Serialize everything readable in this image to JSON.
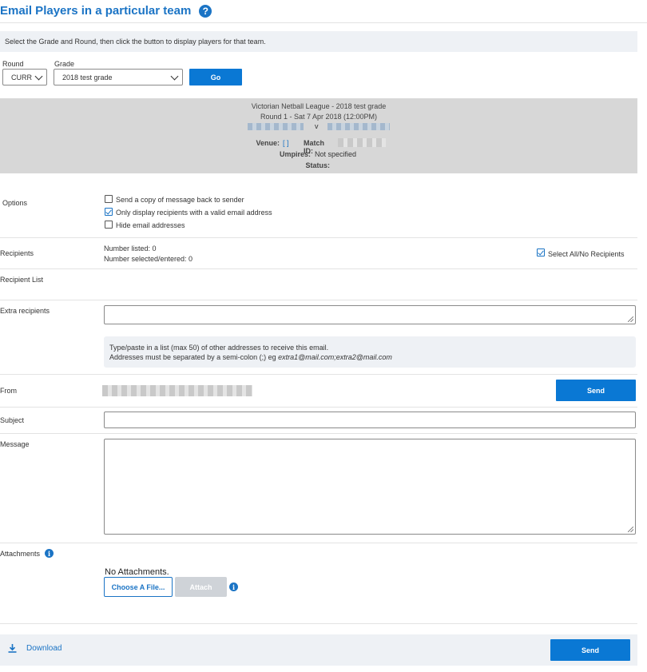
{
  "page": {
    "title": "Email Players in a particular team",
    "help_icon": "?",
    "hint": "Select the Grade and Round, then click the button to display players for that team."
  },
  "filters": {
    "round_label": "Round",
    "round_value": "CURR",
    "grade_label": "Grade",
    "grade_value": "2018 test grade",
    "go_label": "Go"
  },
  "match": {
    "competition": "Victorian Netball League - 2018 test grade",
    "round": "Round 1 - Sat 7 Apr 2018 (12:00PM)",
    "versus": "v",
    "venue_label": "Venue:",
    "venue_value": "[ ]",
    "match_id_label": "Match ID:",
    "umpires_label": "Umpires:",
    "umpires_value": "Not specified",
    "status_label": "Status:"
  },
  "options": {
    "label": "Options",
    "items": [
      {
        "label": "Send a copy of message back to sender",
        "checked": false
      },
      {
        "label": "Only display recipients with a valid email address",
        "checked": true
      },
      {
        "label": "Hide email addresses",
        "checked": false
      }
    ]
  },
  "recipients": {
    "label": "Recipients",
    "listed": "Number listed: 0",
    "selected": "Number selected/entered: 0",
    "select_all_label": "Select All/No Recipients",
    "select_all_checked": true,
    "list_label": "Recipient List"
  },
  "extra": {
    "label": "Extra recipients",
    "value": "",
    "info_line1": "Type/paste in a list (max 50) of other addresses to receive this email.",
    "info_line2_prefix": "Addresses must be separated by a semi-colon (;) eg ",
    "info_line2_example": "extra1@mail.com;extra2@mail.com"
  },
  "from": {
    "label": "From",
    "send_label": "Send"
  },
  "subject": {
    "label": "Subject",
    "value": ""
  },
  "message": {
    "label": "Message",
    "value": ""
  },
  "attachments": {
    "label": "Attachments",
    "info_icon": "i",
    "status": "No Attachments.",
    "choose_label": "Choose A File...",
    "attach_label": "Attach"
  },
  "footer": {
    "download_label": "Download",
    "send_label": "Send"
  },
  "colors": {
    "accent": "#1b74c5",
    "button": "#0a78d4",
    "panel": "#d7d7d7",
    "hint_bg": "#eef1f5"
  }
}
